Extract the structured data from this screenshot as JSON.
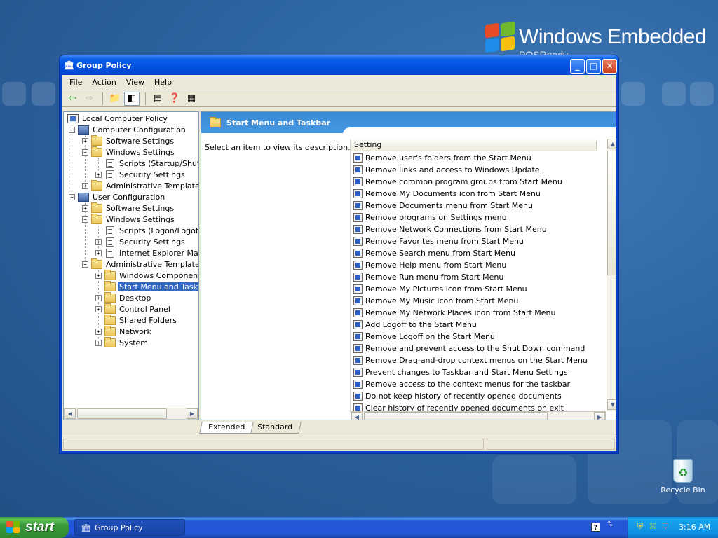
{
  "desktop": {
    "brand_text": "Windows Embedded",
    "brand_sub": "POSReady",
    "recycle_label": "Recycle Bin"
  },
  "window": {
    "title": "Group Policy",
    "menu": [
      "File",
      "Action",
      "View",
      "Help"
    ],
    "buttons": {
      "minimize": "_",
      "maximize": "□",
      "close": "✕"
    }
  },
  "tree": {
    "nodes": [
      {
        "label": "Local Computer Policy",
        "icon": "policy-icon"
      },
      {
        "label": "Computer Configuration",
        "icon": "computer-icon"
      },
      {
        "label": "Software Settings",
        "icon": "folder-icon"
      },
      {
        "label": "Windows Settings",
        "icon": "folder-icon"
      },
      {
        "label": "Scripts (Startup/Shutdo",
        "icon": "document-icon"
      },
      {
        "label": "Security Settings",
        "icon": "security-icon"
      },
      {
        "label": "Administrative Templates",
        "icon": "folder-icon"
      },
      {
        "label": "User Configuration",
        "icon": "user-icon"
      },
      {
        "label": "Software Settings",
        "icon": "folder-icon"
      },
      {
        "label": "Windows Settings",
        "icon": "folder-icon"
      },
      {
        "label": "Scripts (Logon/Logoff)",
        "icon": "document-icon"
      },
      {
        "label": "Security Settings",
        "icon": "security-icon"
      },
      {
        "label": "Internet Explorer Maint",
        "icon": "ie-icon"
      },
      {
        "label": "Administrative Templates",
        "icon": "folder-icon"
      },
      {
        "label": "Windows Components",
        "icon": "folder-icon"
      },
      {
        "label": "Start Menu and Taskba",
        "icon": "folder-open-icon"
      },
      {
        "label": "Desktop",
        "icon": "folder-icon"
      },
      {
        "label": "Control Panel",
        "icon": "folder-icon"
      },
      {
        "label": "Shared Folders",
        "icon": "folder-icon"
      },
      {
        "label": "Network",
        "icon": "folder-icon"
      },
      {
        "label": "System",
        "icon": "folder-icon"
      }
    ]
  },
  "right": {
    "header": "Start Menu and Taskbar",
    "description": "Select an item to view its description.",
    "column_header": "Setting",
    "settings": [
      "Remove user's folders from the Start Menu",
      "Remove links and access to Windows Update",
      "Remove common program groups from Start Menu",
      "Remove My Documents icon from Start Menu",
      "Remove Documents menu from Start Menu",
      "Remove programs on Settings menu",
      "Remove Network Connections from Start Menu",
      "Remove Favorites menu from Start Menu",
      "Remove Search menu from Start Menu",
      "Remove Help menu from Start Menu",
      "Remove Run menu from Start Menu",
      "Remove My Pictures icon from Start Menu",
      "Remove My Music icon from Start Menu",
      "Remove My Network Places icon from Start Menu",
      "Add Logoff to the Start Menu",
      "Remove Logoff on the Start Menu",
      "Remove and prevent access to the Shut Down command",
      "Remove Drag-and-drop context menus on the Start Menu",
      "Prevent changes to Taskbar and Start Menu Settings",
      "Remove access to the context menus for the taskbar",
      "Do not keep history of recently opened documents",
      "Clear history of recently opened documents on exit"
    ],
    "tabs": [
      "Extended",
      "Standard"
    ]
  },
  "taskbar": {
    "start_label": "start",
    "task_label": "Group Policy",
    "clock": "3:16 AM"
  }
}
